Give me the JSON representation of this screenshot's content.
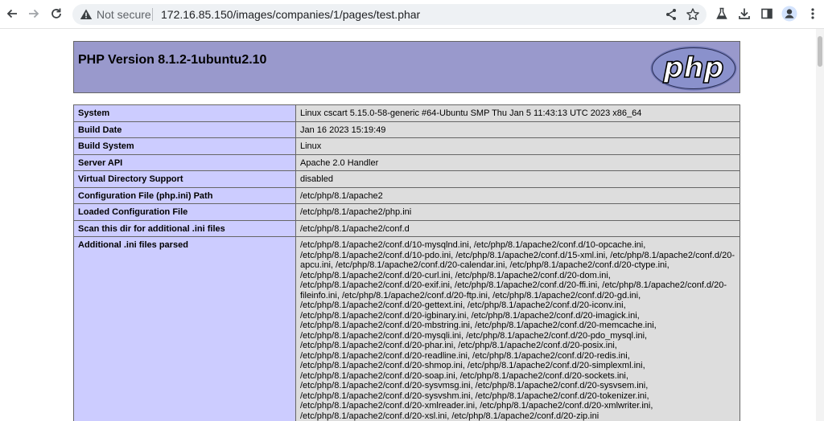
{
  "browser": {
    "security_label": "Not secure",
    "url": "172.16.85.150/images/companies/1/pages/test.phar"
  },
  "page": {
    "title": "PHP Version 8.1.2-1ubuntu2.10",
    "logo_text": "php",
    "rows": [
      {
        "key": "System",
        "value": "Linux cscart 5.15.0-58-generic #64-Ubuntu SMP Thu Jan 5 11:43:13 UTC 2023 x86_64"
      },
      {
        "key": "Build Date",
        "value": "Jan 16 2023 15:19:49"
      },
      {
        "key": "Build System",
        "value": "Linux"
      },
      {
        "key": "Server API",
        "value": "Apache 2.0 Handler"
      },
      {
        "key": "Virtual Directory Support",
        "value": "disabled"
      },
      {
        "key": "Configuration File (php.ini) Path",
        "value": "/etc/php/8.1/apache2"
      },
      {
        "key": "Loaded Configuration File",
        "value": "/etc/php/8.1/apache2/php.ini"
      },
      {
        "key": "Scan this dir for additional .ini files",
        "value": "/etc/php/8.1/apache2/conf.d"
      },
      {
        "key": "Additional .ini files parsed",
        "value": "/etc/php/8.1/apache2/conf.d/10-mysqlnd.ini, /etc/php/8.1/apache2/conf.d/10-opcache.ini, /etc/php/8.1/apache2/conf.d/10-pdo.ini, /etc/php/8.1/apache2/conf.d/15-xml.ini, /etc/php/8.1/apache2/conf.d/20-apcu.ini, /etc/php/8.1/apache2/conf.d/20-calendar.ini, /etc/php/8.1/apache2/conf.d/20-ctype.ini, /etc/php/8.1/apache2/conf.d/20-curl.ini, /etc/php/8.1/apache2/conf.d/20-dom.ini, /etc/php/8.1/apache2/conf.d/20-exif.ini, /etc/php/8.1/apache2/conf.d/20-ffi.ini, /etc/php/8.1/apache2/conf.d/20-fileinfo.ini, /etc/php/8.1/apache2/conf.d/20-ftp.ini, /etc/php/8.1/apache2/conf.d/20-gd.ini, /etc/php/8.1/apache2/conf.d/20-gettext.ini, /etc/php/8.1/apache2/conf.d/20-iconv.ini, /etc/php/8.1/apache2/conf.d/20-igbinary.ini, /etc/php/8.1/apache2/conf.d/20-imagick.ini, /etc/php/8.1/apache2/conf.d/20-mbstring.ini, /etc/php/8.1/apache2/conf.d/20-memcache.ini, /etc/php/8.1/apache2/conf.d/20-mysqli.ini, /etc/php/8.1/apache2/conf.d/20-pdo_mysql.ini, /etc/php/8.1/apache2/conf.d/20-phar.ini, /etc/php/8.1/apache2/conf.d/20-posix.ini, /etc/php/8.1/apache2/conf.d/20-readline.ini, /etc/php/8.1/apache2/conf.d/20-redis.ini, /etc/php/8.1/apache2/conf.d/20-shmop.ini, /etc/php/8.1/apache2/conf.d/20-simplexml.ini, /etc/php/8.1/apache2/conf.d/20-soap.ini, /etc/php/8.1/apache2/conf.d/20-sockets.ini, /etc/php/8.1/apache2/conf.d/20-sysvmsg.ini, /etc/php/8.1/apache2/conf.d/20-sysvsem.ini, /etc/php/8.1/apache2/conf.d/20-sysvshm.ini, /etc/php/8.1/apache2/conf.d/20-tokenizer.ini, /etc/php/8.1/apache2/conf.d/20-xmlreader.ini, /etc/php/8.1/apache2/conf.d/20-xmlwriter.ini, /etc/php/8.1/apache2/conf.d/20-xsl.ini, /etc/php/8.1/apache2/conf.d/20-zip.ini"
      }
    ]
  },
  "icons": {
    "back": "arrow-left-icon",
    "forward": "arrow-right-icon",
    "reload": "reload-icon",
    "security": "warning-triangle-icon",
    "share": "share-icon",
    "bookmark": "star-icon",
    "labs": "flask-icon",
    "download": "download-icon",
    "side_panel": "side-panel-icon",
    "profile": "profile-icon",
    "menu": "kebab-menu-icon"
  },
  "colors": {
    "header_bg": "#9999cc",
    "key_bg": "#ccccff",
    "value_bg": "#dddddd",
    "border": "#666666"
  }
}
